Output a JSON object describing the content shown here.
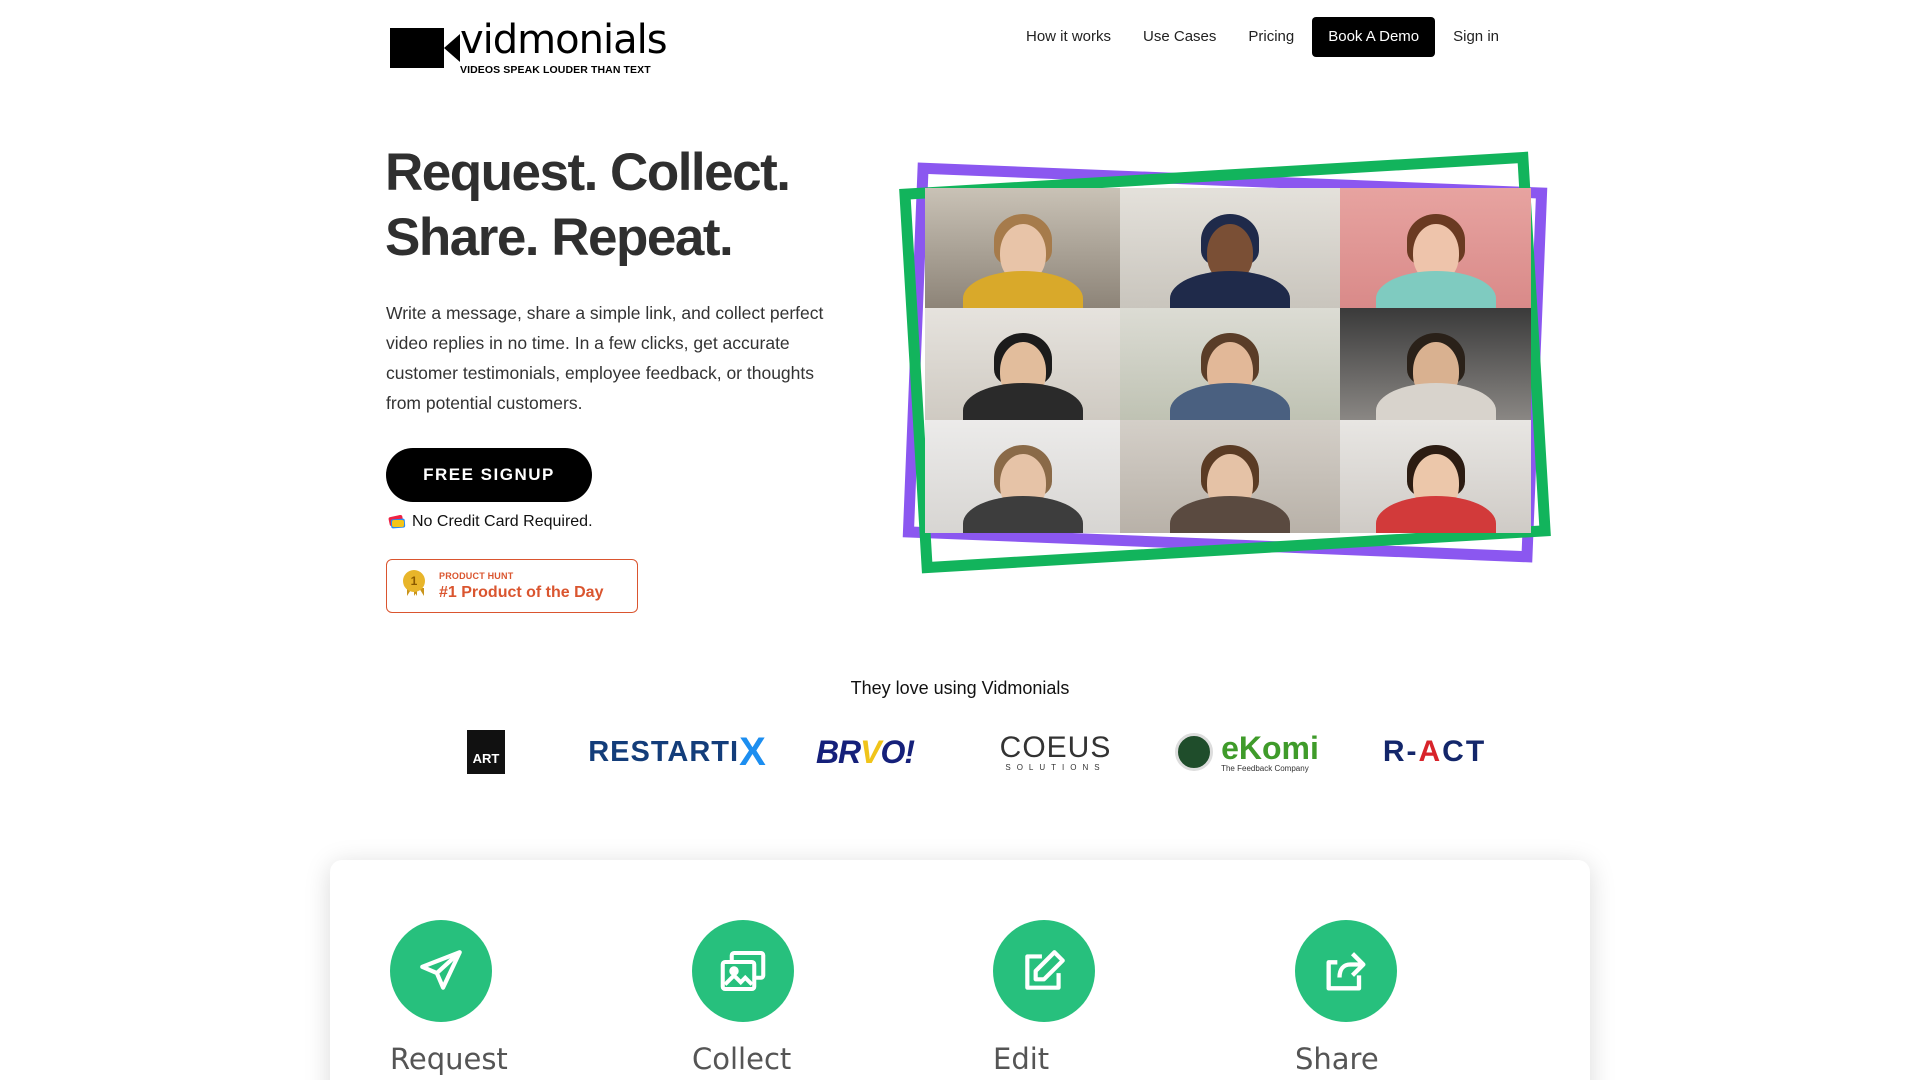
{
  "header": {
    "logo_name": "vidmonials",
    "logo_tagline": "VIDEOS SPEAK LOUDER THAN TEXT",
    "nav": [
      "How it works",
      "Use Cases",
      "Pricing",
      "Book A Demo",
      "Sign in"
    ]
  },
  "hero": {
    "title_line1": "Request. Collect.",
    "title_line2": "Share. Repeat.",
    "description": "Write a message, share a simple link, and collect perfect video replies in no time. In a few clicks, get accurate customer testimonials, employee feedback, or thoughts from potential customers.",
    "cta_label": "FREE SIGNUP",
    "no_cc_text": "No Credit Card Required.",
    "badge_small": "PRODUCT HUNT",
    "badge_big": "#1 Product of the Day",
    "badge_medal_number": "1"
  },
  "customers": {
    "heading": "They love using Vidmonials",
    "logos": {
      "art": "ART",
      "restartix_main": "RESTARTI",
      "restartix_x": "X",
      "bravo_1": "BR",
      "bravo_2": "V",
      "bravo_3": "O!",
      "coeus_name": "COEUS",
      "coeus_sub": "SOLUTIONS",
      "ekomi_name": "eKomi",
      "ekomi_sub": "The Feedback Company",
      "react_1": "R-",
      "react_2": "A",
      "react_3": "CT"
    }
  },
  "features": [
    {
      "label": "Request",
      "icon": "paper-plane-icon"
    },
    {
      "label": "Collect",
      "icon": "images-icon"
    },
    {
      "label": "Edit",
      "icon": "edit-icon"
    },
    {
      "label": "Share",
      "icon": "share-icon"
    }
  ],
  "colors": {
    "accent_green": "#27c07d",
    "frame_purple": "#8b57f0",
    "frame_green": "#12b45c",
    "product_hunt": "#da552f"
  }
}
